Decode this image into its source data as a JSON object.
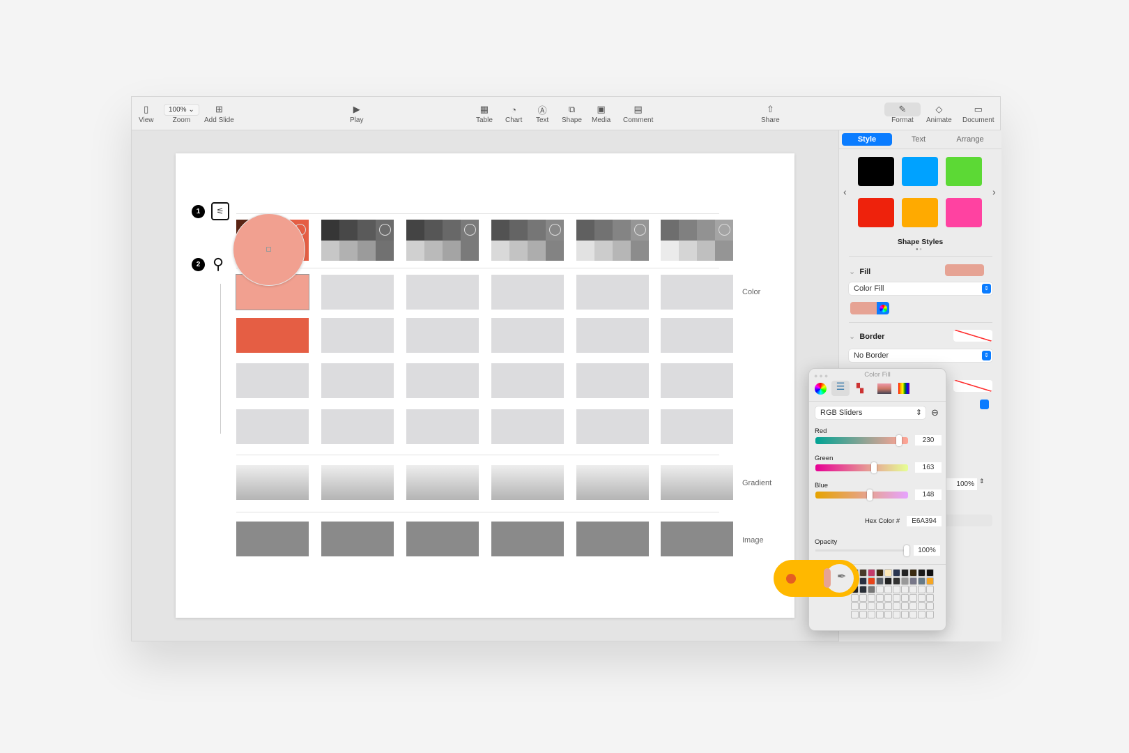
{
  "toolbar": {
    "view": "View",
    "zoom_value": "100%",
    "zoom": "Zoom",
    "add_slide": "Add Slide",
    "play": "Play",
    "table": "Table",
    "chart": "Chart",
    "text": "Text",
    "shape": "Shape",
    "media": "Media",
    "comment": "Comment",
    "share": "Share",
    "format": "Format",
    "animate": "Animate",
    "document": "Document"
  },
  "sidebar": {
    "tabs": [
      "Style",
      "Text",
      "Arrange"
    ],
    "shape_styles_label": "Shape Styles",
    "shape_styles": [
      "#000000",
      "#00a2ff",
      "#5cd935",
      "#ee220c",
      "#ffaa00",
      "#ff42a1"
    ],
    "fill_label": "Fill",
    "fill_type": "Color Fill",
    "fill_color": "#e6a394",
    "border_label": "Border",
    "border_type": "No Border",
    "opacity_value": "100%"
  },
  "slide": {
    "markers": [
      "1",
      "2"
    ],
    "row_labels": {
      "color": "Color",
      "gradient": "Gradient",
      "image": "Image"
    },
    "selected_shape_color": "#f1a090",
    "accent_cell_color": "#e55e44"
  },
  "color_panel": {
    "title": "Color Fill",
    "mode": "RGB Sliders",
    "red_label": "Red",
    "red": "230",
    "green_label": "Green",
    "green": "163",
    "blue_label": "Blue",
    "blue": "148",
    "hex_label": "Hex Color #",
    "hex": "E6A394",
    "opacity_label": "Opacity",
    "opacity": "100%",
    "current_color": "#e6a394"
  },
  "callout_color": "#ffb800"
}
